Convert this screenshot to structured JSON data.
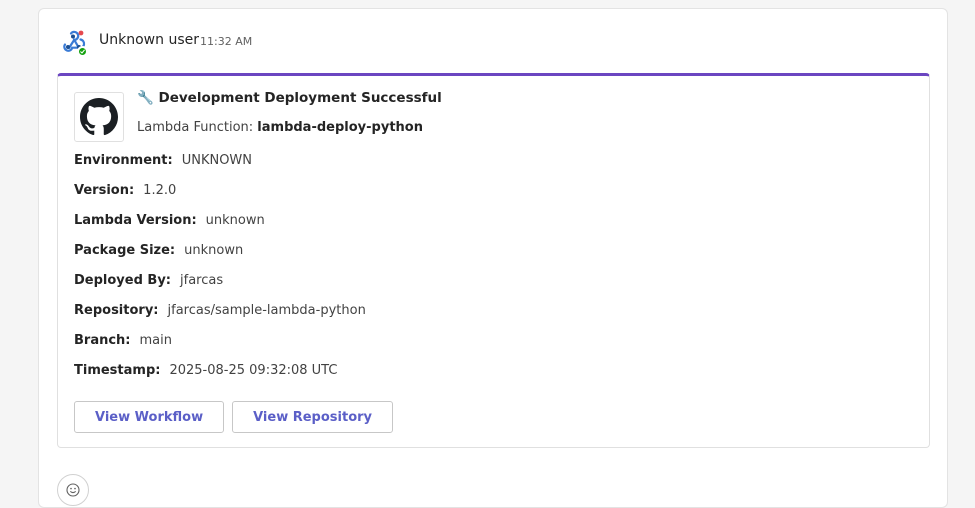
{
  "message": {
    "sender": "Unknown user",
    "time": "11:32 AM"
  },
  "card": {
    "accent_color": "#6b46c1",
    "title_icon": "wrench-icon",
    "title": "🔧 Development Deployment Successful",
    "subtitle_label": "Lambda Function: ",
    "subtitle_value": "lambda-deploy-python",
    "logo_icon": "github-icon",
    "facts": [
      {
        "key": "Environment:",
        "value": "UNKNOWN"
      },
      {
        "key": "Version:",
        "value": "1.2.0"
      },
      {
        "key": "Lambda Version:",
        "value": "unknown"
      },
      {
        "key": "Package Size:",
        "value": "unknown"
      },
      {
        "key": "Deployed By:",
        "value": "jfarcas"
      },
      {
        "key": "Repository:",
        "value": "jfarcas/sample-lambda-python"
      },
      {
        "key": "Branch:",
        "value": "main"
      },
      {
        "key": "Timestamp:",
        "value": "2025-08-25 09:32:08 UTC"
      }
    ],
    "actions": {
      "view_workflow": "View Workflow",
      "view_repository": "View Repository"
    }
  }
}
